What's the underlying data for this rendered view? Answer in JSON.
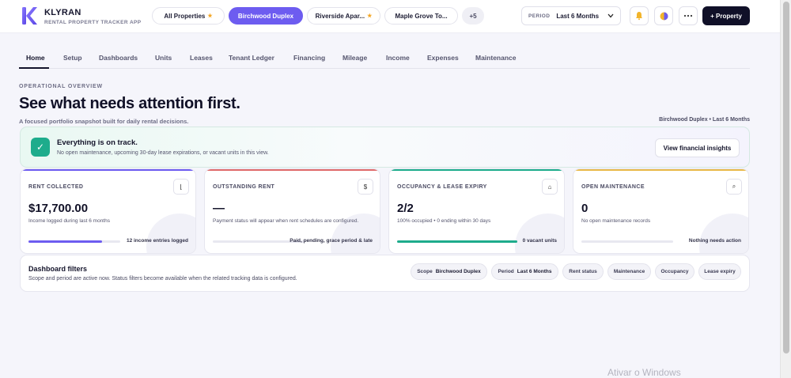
{
  "brand": {
    "name": "KLYRAN",
    "tagline": "RENTAL PROPERTY TRACKER APP",
    "logo_letter": "K"
  },
  "property_chips": [
    {
      "label": "All Properties",
      "starred": true,
      "active": false
    },
    {
      "label": "Birchwood Duplex",
      "starred": false,
      "active": true
    },
    {
      "label": "Riverside Apar...",
      "starred": true,
      "active": false
    },
    {
      "label": "Maple Grove To...",
      "starred": false,
      "active": false
    }
  ],
  "more_properties": "+5",
  "period": {
    "label": "PERIOD",
    "value": "Last 6 Months"
  },
  "header_icons": [
    "bell-icon",
    "theme-toggle-icon",
    "more-icon"
  ],
  "add_property_label": "+ Property",
  "tabs": [
    "Home",
    "Setup",
    "Dashboards",
    "Units",
    "Leases",
    "Tenant Ledger",
    "Financing",
    "Mileage",
    "Income",
    "Expenses",
    "Maintenance"
  ],
  "active_tab": "Home",
  "overview": {
    "eyebrow": "OPERATIONAL OVERVIEW",
    "headline": "See what needs attention first.",
    "subhead": "A focused portfolio snapshot built for daily rental decisions.",
    "scope_note": "Birchwood Duplex • Last 6 Months"
  },
  "banner": {
    "title": "Everything is on track.",
    "description": "No open maintenance, upcoming 30-day lease expirations, or vacant units in this view.",
    "cta": "View financial insights"
  },
  "cards": [
    {
      "title": "RENT COLLECTED",
      "icon": "chart-icon",
      "icon_glyph": "⌊",
      "value": "$17,700.00",
      "note": "Income logged during last 6 months",
      "progress": 0.8,
      "color": "#6d5cf0",
      "footer": "12 income entries logged"
    },
    {
      "title": "OUTSTANDING RENT",
      "icon": "dollar-icon",
      "icon_glyph": "$",
      "value": "—",
      "note": "Payment status will appear when rent schedules are configured.",
      "progress": 0,
      "color": "#e06b6b",
      "footer": "Paid, pending, grace period & late"
    },
    {
      "title": "OCCUPANCY & LEASE EXPIRY",
      "icon": "home-icon",
      "icon_glyph": "⌂",
      "value": "2/2",
      "note": "100% occupied • 0 ending within 30 days",
      "progress": 1.0,
      "color": "#1eac8c",
      "footer": "0 vacant units"
    },
    {
      "title": "OPEN MAINTENANCE",
      "icon": "search-icon",
      "icon_glyph": "⌕",
      "value": "0",
      "note": "No open maintenance records",
      "progress": 0,
      "color": "#e9b949",
      "footer": "Nothing needs action"
    }
  ],
  "filters": {
    "title": "Dashboard filters",
    "description": "Scope and period are active now. Status filters become available when the related tracking data is configured.",
    "chips": [
      {
        "label": "Scope",
        "value": "Birchwood Duplex"
      },
      {
        "label": "Period",
        "value": "Last 6 Months"
      },
      {
        "label": "Rent status",
        "value": ""
      },
      {
        "label": "Maintenance",
        "value": ""
      },
      {
        "label": "Occupancy",
        "value": ""
      },
      {
        "label": "Lease expiry",
        "value": ""
      }
    ]
  },
  "watermark": "Ativar o Windows"
}
